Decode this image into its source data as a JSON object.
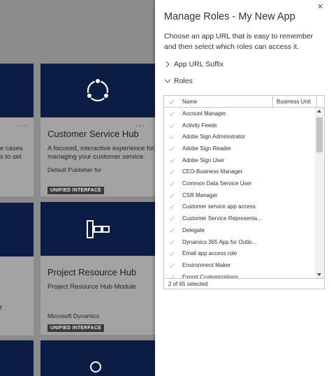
{
  "background": {
    "cards": [
      {
        "title": "Customer Service Hub",
        "description_lines": [
          "A focused, interactive experience for",
          "managing your customer service."
        ],
        "publisher": "Default Publisher for",
        "badge": "UNIFIED INTERFACE",
        "icon": "hub-network-icon"
      },
      {
        "title": "Project Resource Hub",
        "description_lines": [
          "Project Resource Hub Module"
        ],
        "publisher": "Microsoft Dynamics",
        "badge": "UNIFIED INTERFACE",
        "icon": "org-chart-icon"
      }
    ],
    "partial_left_text": [
      "e cases",
      "s to set"
    ],
    "partial_left_text2": "t",
    "more_label": "···"
  },
  "panel": {
    "title": "Manage Roles  -  My New App",
    "description": "Choose an app URL that is easy to remember and then select which roles can access it.",
    "url_suffix_label": "App URL Suffix",
    "roles_label": "Roles",
    "grid": {
      "col_name": "Name",
      "col_bu": "Business Unit",
      "rows": [
        "Account Manager",
        "Activity Feeds",
        "Adobe Sign Administrator",
        "Adobe Sign Reader",
        "Adobe Sign User",
        "CEO-Business Manager",
        "Common Data Service User",
        "CSR Manager",
        "Customer service app access",
        "Customer Service Representa...",
        "Delegate",
        "Dynamics 365 App for Outlo...",
        "Email app access role",
        "Environment Maker",
        "Export Customizations"
      ],
      "footer": "2 of 65 selected"
    }
  },
  "colors": {
    "card_header": "#0b1d44",
    "panel_bg": "#ffffff",
    "overlay": "#8c8c8c"
  }
}
